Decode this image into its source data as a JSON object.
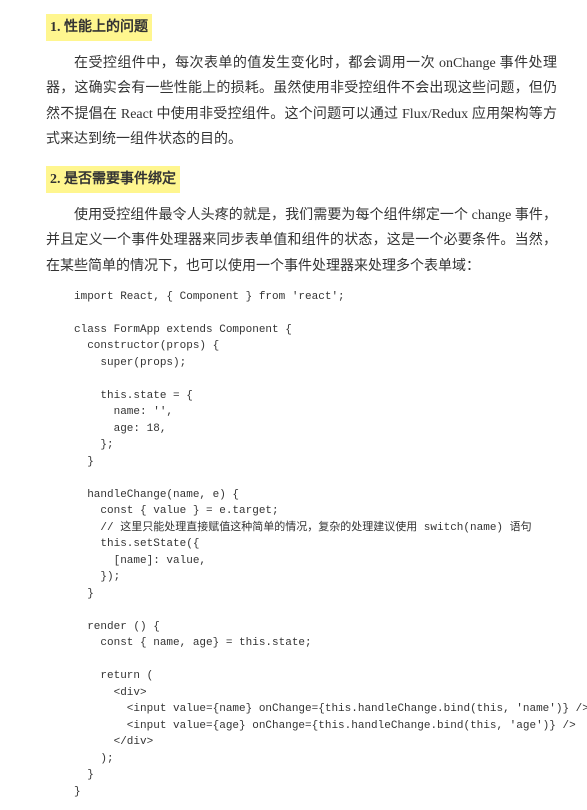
{
  "section1": {
    "heading": "1. 性能上的问题",
    "para": "在受控组件中，每次表单的值发生变化时，都会调用一次 onChange 事件处理器，这确实会有一些性能上的损耗。虽然使用非受控组件不会出现这些问题，但仍然不提倡在 React 中使用非受控组件。这个问题可以通过 Flux/Redux 应用架构等方式来达到统一组件状态的目的。"
  },
  "section2": {
    "heading": "2. 是否需要事件绑定",
    "para": "使用受控组件最令人头疼的就是，我们需要为每个组件绑定一个 change 事件，并且定义一个事件处理器来同步表单值和组件的状态，这是一个必要条件。当然，在某些简单的情况下，也可以使用一个事件处理器来处理多个表单域："
  },
  "code": "import React, { Component } from 'react';\n\nclass FormApp extends Component {\n  constructor(props) {\n    super(props);\n\n    this.state = {\n      name: '',\n      age: 18,\n    };\n  }\n\n  handleChange(name, e) {\n    const { value } = e.target;\n    // 这里只能处理直接赋值这种简单的情况，复杂的处理建议使用 switch(name) 语句\n    this.setState({\n      [name]: value,\n    });\n  }\n\n  render () {\n    const { name, age} = this.state;\n\n    return (\n      <div>\n        <input value={name} onChange={this.handleChange.bind(this, 'name')} />\n        <input value={age} onChange={this.handleChange.bind(this, 'age')} />\n      </div>\n    );\n  }\n}"
}
